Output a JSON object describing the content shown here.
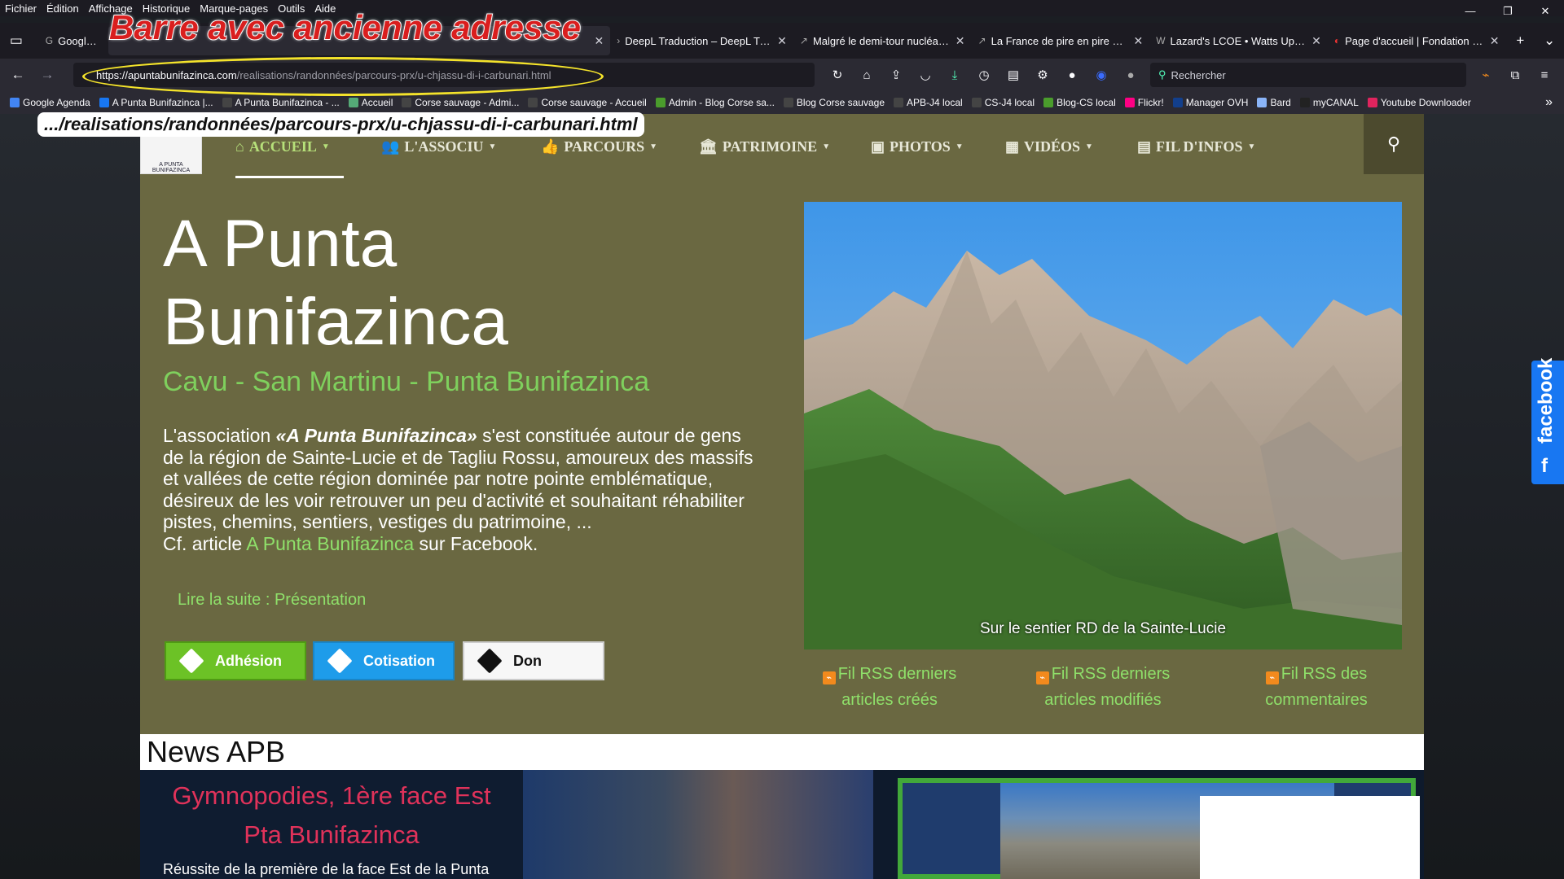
{
  "menubar": [
    "Fichier",
    "Édition",
    "Affichage",
    "Historique",
    "Marque-pages",
    "Outils",
    "Aide"
  ],
  "tabs": [
    {
      "label": "Google Ag",
      "icon": "G"
    },
    {
      "label": "DeepL Traduction – DeepL Trans",
      "icon": "›"
    },
    {
      "label": "Malgré le demi-tour nucléaire d",
      "icon": "↗"
    },
    {
      "label": "La France de pire en pire et de P",
      "icon": "↗"
    },
    {
      "label": "Lazard's LCOE • Watts Up With",
      "icon": "W"
    },
    {
      "label": "Page d'accueil | Fondation IFRA",
      "icon": "◐"
    }
  ],
  "address": {
    "domain": "https://apuntabunifazinca.com",
    "path": "/realisations/randonnées/parcours-prx/u-chjassu-di-i-carbunari.html"
  },
  "search": {
    "placeholder": "Rechercher"
  },
  "bookmarks": [
    {
      "label": "Google Agenda",
      "color": "#4285f4"
    },
    {
      "label": "A Punta Bunifazinca |...",
      "color": "#1877f2"
    },
    {
      "label": "A Punta Bunifazinca - ...",
      "color": "#444"
    },
    {
      "label": "Accueil",
      "color": "#5a7"
    },
    {
      "label": "Corse sauvage - Admi...",
      "color": "#444"
    },
    {
      "label": "Corse sauvage - Accueil",
      "color": "#444"
    },
    {
      "label": "Admin - Blog Corse sa...",
      "color": "#4a9c2c"
    },
    {
      "label": "Blog Corse sauvage",
      "color": "#444"
    },
    {
      "label": "APB-J4 local",
      "color": "#444"
    },
    {
      "label": "CS-J4 local",
      "color": "#444"
    },
    {
      "label": "Blog-CS local",
      "color": "#4a9c2c"
    },
    {
      "label": "Flickr!",
      "color": "#ff0084"
    },
    {
      "label": "Manager OVH",
      "color": "#123f8c"
    },
    {
      "label": "Bard",
      "color": "#8ab4f8"
    },
    {
      "label": "myCANAL",
      "color": "#222"
    },
    {
      "label": "Youtube Downloader",
      "color": "#e0245e"
    }
  ],
  "annotations": {
    "title": "Barre avec ancienne adresse",
    "path": ".../realisations/randonnées/parcours-prx/u-chjassu-di-i-carbunari.html"
  },
  "site": {
    "nav": [
      "ACCUEIL",
      "L'ASSOCIU",
      "PARCOURS",
      "PATRIMOINE",
      "PHOTOS",
      "VIDÉOS",
      "FIL D'INFOS"
    ],
    "logo_text": "A PUNTA BUNIFAZINCA",
    "title_line1": "A Punta",
    "title_line2": "Bunifazinca",
    "subtitle": "Cavu - San Martinu - Punta Bunifazinca",
    "para_pre": "L'association ",
    "para_name": "«A Punta Bunifazinca»",
    "para_post": " s'est constituée autour de gens de la région de Sainte-Lucie et de Tagliu Rossu, amoureux des massifs et vallées de cette région dominée par notre pointe emblématique, désireux de les voir retrouver un peu d'activité et souhaitant réhabiliter pistes, chemins, sentiers, vestiges du patrimoine, ...",
    "cf_pre": "Cf. article ",
    "cf_link": "A Punta Bunifazinca",
    "cf_post": " sur Facebook.",
    "read_more": "Lire la suite : Présentation",
    "buttons": [
      "Adhésion",
      "Cotisation",
      "Don"
    ],
    "photo_caption": "Sur le sentier RD de la Sainte-Lucie",
    "rss": [
      {
        "line1": "Fil RSS derniers",
        "line2": "articles créés"
      },
      {
        "line1": "Fil RSS derniers",
        "line2": "articles modifiés"
      },
      {
        "line1": "Fil RSS des",
        "line2": "commentaires"
      }
    ],
    "news_heading": "News APB",
    "news_title_1": "Gymnopodies, 1ère face Est",
    "news_title_2": "Pta Bunifazinca",
    "news_text": "Réussite de la première de la face Est de la Punta",
    "facebook": "facebook"
  }
}
